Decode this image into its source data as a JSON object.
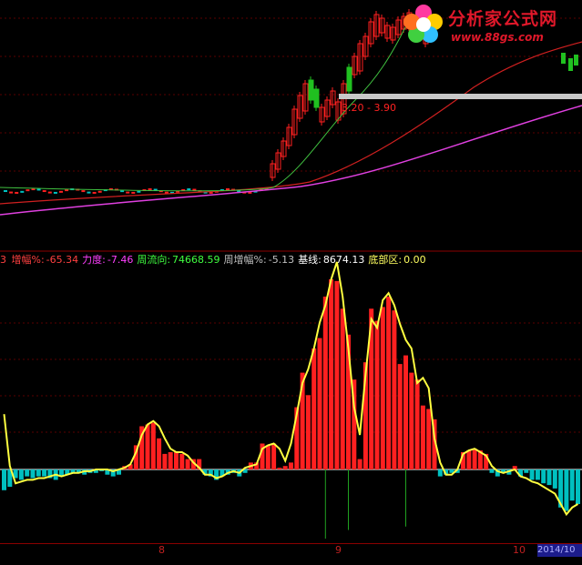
{
  "watermark": {
    "title": "分析家公式网",
    "url": "www.88gs.com"
  },
  "price_panel": {
    "range_label": "3.20 - 3.90"
  },
  "indicator": {
    "prefix": "3",
    "items": [
      {
        "label": "增幅%:",
        "value": "-65.34",
        "color": "#ff4040"
      },
      {
        "label": "力度:",
        "value": "-7.46",
        "color": "#ff40ff"
      },
      {
        "label": "周流向:",
        "value": "74668.59",
        "color": "#40ff40"
      },
      {
        "label": "周增幅%:",
        "value": "-5.13",
        "color": "#c0c0c0"
      },
      {
        "label": "基线:",
        "value": "8674.13",
        "color": "#ffffff"
      },
      {
        "label": "底部区:",
        "value": "0.00",
        "color": "#ffff60"
      }
    ]
  },
  "x_axis": {
    "labels": [
      "8",
      "9",
      "10"
    ],
    "highlight": "2014/10"
  },
  "colors": {
    "up": "#ff2020",
    "down": "#00c0c0",
    "line": "#ffff40",
    "ma_long": "#e040e0",
    "ma_mid": "#d02020",
    "ma_short": "#40c040"
  },
  "chart_data": {
    "type": "bar",
    "title": "",
    "bars": [
      -12,
      -10,
      -5,
      -6,
      -4,
      -5,
      -4,
      -4,
      -5,
      -6,
      -4,
      -3,
      -2,
      -2,
      -3,
      -2,
      -2,
      -1,
      -3,
      -4,
      -3,
      2,
      3,
      14,
      25,
      26,
      27,
      18,
      9,
      10,
      10,
      9,
      6,
      6,
      6,
      -3,
      -4,
      -6,
      -4,
      -3,
      -2,
      -4,
      -2,
      4,
      4,
      15,
      14,
      15,
      1,
      2,
      4,
      36,
      56,
      43,
      70,
      76,
      100,
      110,
      109,
      93,
      78,
      52,
      6,
      62,
      93,
      86,
      94,
      100,
      92,
      61,
      66,
      56,
      52,
      37,
      35,
      29,
      -4,
      -3,
      -2,
      -2,
      10,
      11,
      12,
      11,
      9,
      -2,
      -4,
      -2,
      -3,
      2,
      -4,
      -2,
      -6,
      -6,
      -8,
      -9,
      -11,
      -22,
      -24,
      -18,
      -20
    ],
    "line": [
      32,
      2,
      -8,
      -7,
      -6,
      -6,
      -5,
      -5,
      -4,
      -3,
      -4,
      -3,
      -2,
      -2,
      -1,
      -1,
      0,
      0,
      0,
      -1,
      0,
      1,
      3,
      10,
      20,
      26,
      28,
      25,
      18,
      12,
      10,
      10,
      8,
      4,
      1,
      -3,
      -3,
      -5,
      -4,
      -2,
      -1,
      -2,
      1,
      2,
      3,
      12,
      14,
      15,
      12,
      5,
      15,
      32,
      50,
      58,
      70,
      85,
      95,
      110,
      120,
      100,
      70,
      36,
      20,
      55,
      87,
      82,
      98,
      102,
      95,
      84,
      75,
      70,
      50,
      53,
      47,
      18,
      4,
      -3,
      -3,
      0,
      9,
      11,
      12,
      10,
      8,
      2,
      -1,
      -2,
      -1,
      0,
      -4,
      -5,
      -7,
      -8,
      -10,
      -12,
      -14,
      -20,
      -26,
      -22,
      -20
    ],
    "spikes_down": [
      {
        "index": 56,
        "value": -40
      },
      {
        "index": 60,
        "value": -35
      },
      {
        "index": 70,
        "value": -33
      }
    ],
    "ylim": [
      -45,
      130
    ]
  }
}
